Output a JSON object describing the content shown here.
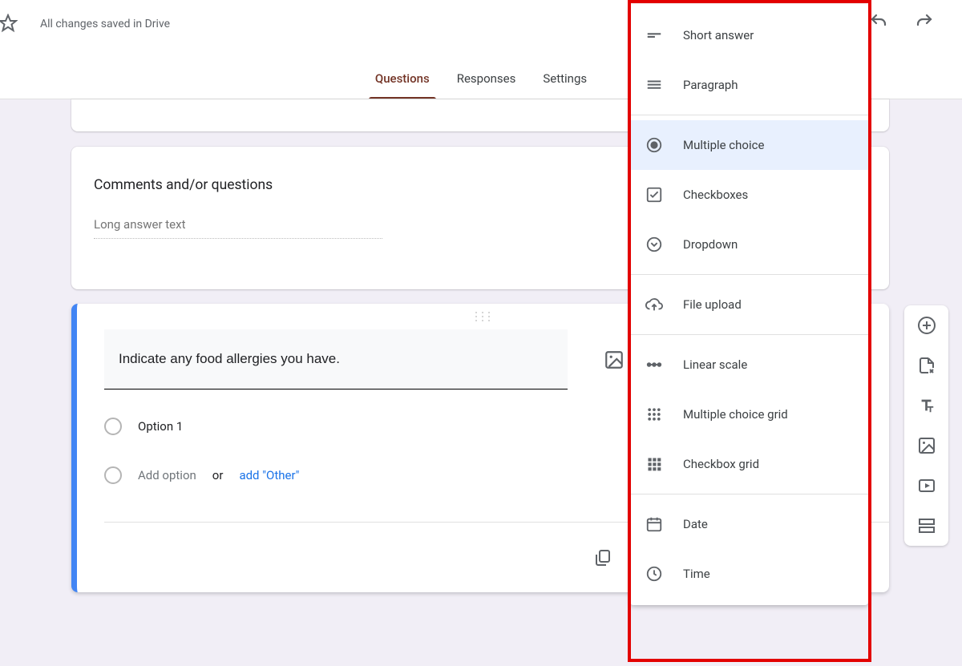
{
  "topbar": {
    "save_status": "All changes saved in Drive"
  },
  "tabs": {
    "questions": "Questions",
    "responses": "Responses",
    "settings": "Settings"
  },
  "comments_card": {
    "title": "Comments and/or questions",
    "placeholder": "Long answer text"
  },
  "question_card": {
    "prompt": "Indicate any food allergies you have.",
    "option1": "Option 1",
    "add_option": "Add option",
    "or": "or",
    "add_other": "add \"Other\""
  },
  "type_menu": {
    "short_answer": "Short answer",
    "paragraph": "Paragraph",
    "multiple_choice": "Multiple choice",
    "checkboxes": "Checkboxes",
    "dropdown": "Dropdown",
    "file_upload": "File upload",
    "linear_scale": "Linear scale",
    "mc_grid": "Multiple choice grid",
    "cb_grid": "Checkbox grid",
    "date": "Date",
    "time": "Time"
  }
}
